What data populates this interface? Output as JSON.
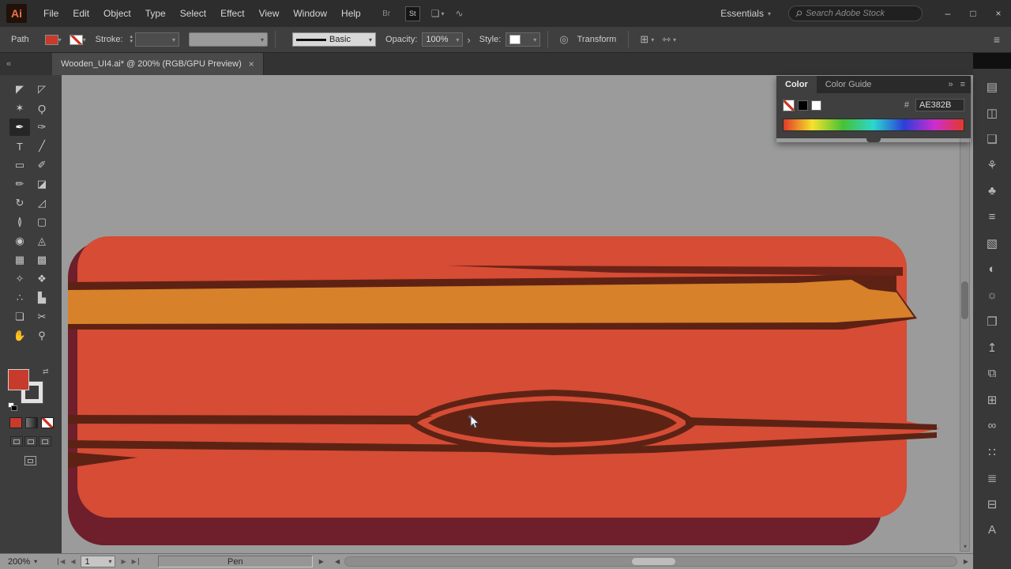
{
  "colors": {
    "accent_red": "#c73b2c",
    "canvas_bg": "#9b9b9b",
    "plank_fill": "#d64c34",
    "plank_shadow": "#6e1f2b",
    "stripe_orange": "#d8812b",
    "stripe_shadow": "#5e2214",
    "knot_brown": "#5c2315",
    "streak_brown": "#6b2217"
  },
  "menubar": {
    "app_badge": "Ai",
    "menus": [
      "File",
      "Edit",
      "Object",
      "Type",
      "Select",
      "Effect",
      "View",
      "Window",
      "Help"
    ],
    "bridge_label": "Br",
    "stock_label": "St",
    "workspace_label": "Essentials",
    "search_placeholder": "Search Adobe Stock",
    "minimize": "–",
    "restore": "□",
    "close": "×"
  },
  "control_bar": {
    "context_label": "Path",
    "stroke_label": "Stroke:",
    "brush_value": "Basic",
    "opacity_label": "Opacity:",
    "opacity_value": "100%",
    "opacity_more": "›",
    "style_label": "Style:",
    "transform_label": "Transform"
  },
  "tabbar": {
    "doc_title": "Wooden_UI4.ai* @ 200% (RGB/GPU Preview)",
    "close": "×",
    "collapse": "«"
  },
  "toolbar": {
    "tools": [
      {
        "id": "selection",
        "glyph": "◤"
      },
      {
        "id": "direct-selection",
        "glyph": "◸"
      },
      {
        "id": "magic-wand",
        "glyph": "✶"
      },
      {
        "id": "lasso",
        "glyph": "Ϙ"
      },
      {
        "id": "pen",
        "glyph": "✒",
        "active": true
      },
      {
        "id": "curvature",
        "glyph": "✑"
      },
      {
        "id": "type",
        "glyph": "T"
      },
      {
        "id": "line-segment",
        "glyph": "╱"
      },
      {
        "id": "rectangle",
        "glyph": "▭"
      },
      {
        "id": "paintbrush",
        "glyph": "✐"
      },
      {
        "id": "pencil",
        "glyph": "✏"
      },
      {
        "id": "eraser",
        "glyph": "◪"
      },
      {
        "id": "rotate",
        "glyph": "↻"
      },
      {
        "id": "scale",
        "glyph": "◿"
      },
      {
        "id": "width",
        "glyph": "≬"
      },
      {
        "id": "free-transform",
        "glyph": "▢"
      },
      {
        "id": "shape-builder",
        "glyph": "◉"
      },
      {
        "id": "perspective-grid",
        "glyph": "◬"
      },
      {
        "id": "mesh",
        "glyph": "▦"
      },
      {
        "id": "gradient",
        "glyph": "▩"
      },
      {
        "id": "eyedropper",
        "glyph": "✧"
      },
      {
        "id": "blend",
        "glyph": "❖"
      },
      {
        "id": "symbol-sprayer",
        "glyph": "∴"
      },
      {
        "id": "column-graph",
        "glyph": "▙"
      },
      {
        "id": "artboard",
        "glyph": "❏"
      },
      {
        "id": "slice",
        "glyph": "✂"
      },
      {
        "id": "hand",
        "glyph": "✋"
      },
      {
        "id": "zoom",
        "glyph": "⚲"
      }
    ]
  },
  "color_panel": {
    "tab_color": "Color",
    "tab_color_guide": "Color Guide",
    "collapse": "»",
    "menu": "≡",
    "hex_label": "#",
    "hex_value": "AE382B"
  },
  "dock": {
    "icons": [
      {
        "id": "libraries",
        "glyph": "▤"
      },
      {
        "id": "info",
        "glyph": "◫"
      },
      {
        "id": "asset-export",
        "glyph": "❑"
      },
      {
        "id": "brushes",
        "glyph": "⚘"
      },
      {
        "id": "symbols",
        "glyph": "♣"
      },
      {
        "id": "stroke",
        "glyph": "≡"
      },
      {
        "id": "gradient",
        "glyph": "▧"
      },
      {
        "id": "transparency",
        "glyph": "◐"
      },
      {
        "id": "appearance",
        "glyph": "☼"
      },
      {
        "id": "graphic-styles",
        "glyph": "❒"
      },
      {
        "id": "export",
        "glyph": "↥"
      },
      {
        "id": "layers",
        "glyph": "⧉"
      },
      {
        "id": "artboards",
        "glyph": "⊞"
      },
      {
        "id": "sync",
        "glyph": "∞"
      },
      {
        "id": "transform",
        "glyph": "∷"
      },
      {
        "id": "align",
        "glyph": "≣"
      },
      {
        "id": "pathfinder",
        "glyph": "⊟"
      },
      {
        "id": "character",
        "glyph": "A"
      }
    ]
  },
  "status_bar": {
    "zoom": "200%",
    "artboard_value": "1",
    "tool_status": "Pen"
  }
}
